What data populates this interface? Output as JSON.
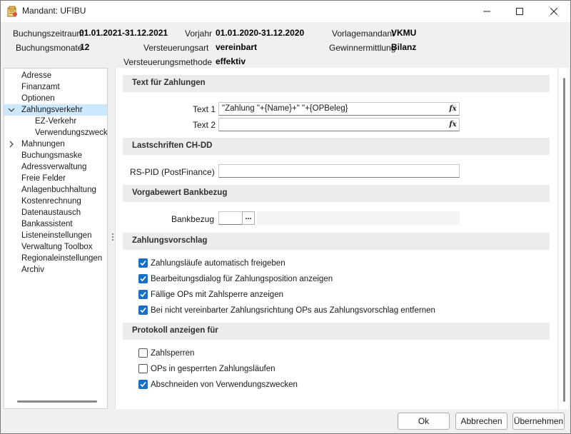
{
  "window": {
    "title": "Mandant: UFIBU"
  },
  "header": {
    "buchungszeitraum_label": "Buchungszeitraum",
    "buchungszeitraum_value": "01.01.2021-31.12.2021",
    "vorjahr_label": "Vorjahr",
    "vorjahr_value": "01.01.2020-31.12.2020",
    "vorlagemandant_label": "Vorlagemandant",
    "vorlagemandant_value": "VKMU",
    "buchungsmonate_label": "Buchungsmonate",
    "buchungsmonate_value": "12",
    "versteuerungsart_label": "Versteuerungsart",
    "versteuerungsart_value": "vereinbart",
    "gewinnermittlung_label": "Gewinnermittlung",
    "gewinnermittlung_value": "Bilanz",
    "versteuerungsmethode_label": "Versteuerungsmethode",
    "versteuerungsmethode_value": "effektiv"
  },
  "sidebar": {
    "items": [
      {
        "label": "Adresse",
        "level": 0
      },
      {
        "label": "Finanzamt",
        "level": 0
      },
      {
        "label": "Optionen",
        "level": 0
      },
      {
        "label": "Zahlungsverkehr",
        "level": 0,
        "expanded": true,
        "selected": true
      },
      {
        "label": "EZ-Verkehr",
        "level": 1
      },
      {
        "label": "Verwendungszwecke",
        "level": 1
      },
      {
        "label": "Mahnungen",
        "level": 0,
        "collapsed": true
      },
      {
        "label": "Buchungsmaske",
        "level": 0
      },
      {
        "label": "Adressverwaltung",
        "level": 0
      },
      {
        "label": "Freie Felder",
        "level": 0
      },
      {
        "label": "Anlagenbuchhaltung",
        "level": 0
      },
      {
        "label": "Kostenrechnung",
        "level": 0
      },
      {
        "label": "Datenaustausch",
        "level": 0
      },
      {
        "label": "Bankassistent",
        "level": 0
      },
      {
        "label": "Listeneinstellungen",
        "level": 0
      },
      {
        "label": "Verwaltung Toolbox",
        "level": 0
      },
      {
        "label": "Regionaleinstellungen",
        "level": 0
      },
      {
        "label": "Archiv",
        "level": 0
      }
    ]
  },
  "main": {
    "text_section_title": "Text für Zahlungen",
    "text1_label": "Text 1",
    "text1_value": "\"Zahlung \"+{Name}+\" \"+{OPBeleg}",
    "text2_label": "Text 2",
    "text2_value": "",
    "fx_icon_text": "fx",
    "lastschriften_title": "Lastschriften CH-DD",
    "rspid_label": "RS-PID (PostFinance)",
    "rspid_value": "",
    "bankbezug_section_title": "Vorgabewert Bankbezug",
    "bankbezug_label": "Bankbezug",
    "bankbezug_value": "",
    "bankbezug_button": "...",
    "zahlungsvorschlag_title": "Zahlungsvorschlag",
    "zahlungsvorschlag_options": [
      {
        "label": "Zahlungsläufe automatisch freigeben",
        "checked": true
      },
      {
        "label": "Bearbeitungsdialog für Zahlungsposition anzeigen",
        "checked": true
      },
      {
        "label": "Fällige OPs mit Zahlsperre anzeigen",
        "checked": true
      },
      {
        "label": "Bei nicht vereinbarter Zahlungsrichtung OPs aus Zahlungsvorschlag entfernen",
        "checked": true
      }
    ],
    "protokoll_title": "Protokoll anzeigen für",
    "protokoll_options": [
      {
        "label": "Zahlsperren",
        "checked": false
      },
      {
        "label": "OPs in gesperrten Zahlungsläufen",
        "checked": false
      },
      {
        "label": "Abschneiden von Verwendungszwecken",
        "checked": true
      }
    ]
  },
  "footer": {
    "ok_label": "Ok",
    "cancel_label": "Abbrechen",
    "apply_label": "Übernehmen"
  },
  "colors": {
    "accent": "#1a6fc4",
    "selection": "#cce8ff",
    "section_bg": "#ececec"
  }
}
